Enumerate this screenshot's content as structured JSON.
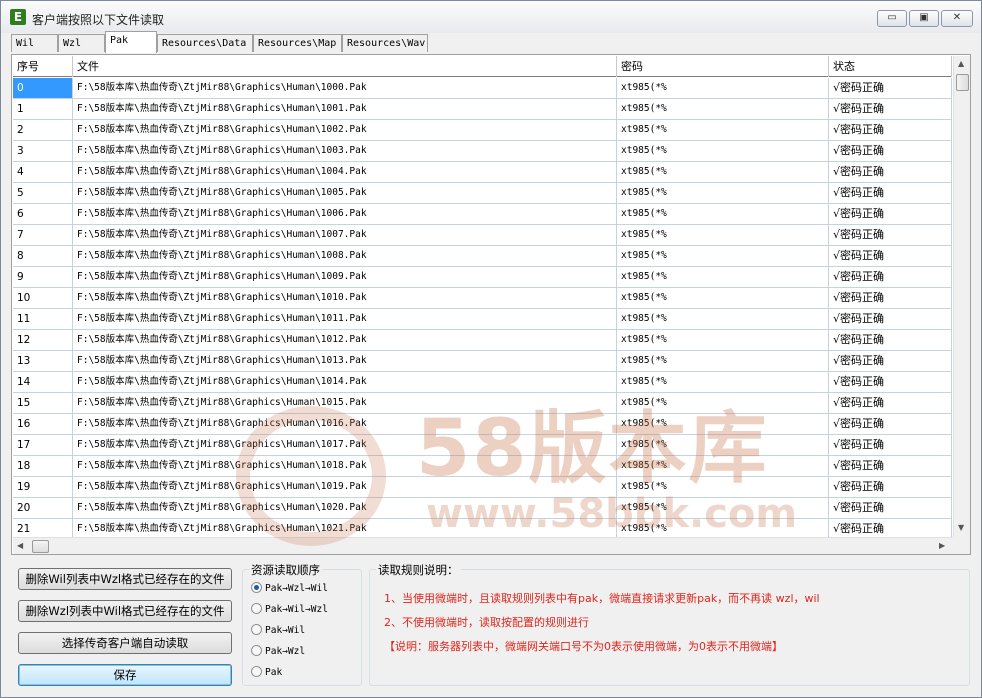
{
  "window": {
    "title": "客户端按照以下文件读取",
    "icon_letter": "E",
    "controls": {
      "minimize": "▭",
      "maximize": "▣",
      "close": "✕"
    }
  },
  "tabs": [
    {
      "label": "Wil",
      "active": false
    },
    {
      "label": "Wzl",
      "active": false
    },
    {
      "label": "Pak",
      "active": true
    },
    {
      "label": "Resources\\Data",
      "active": false
    },
    {
      "label": "Resources\\Map",
      "active": false
    },
    {
      "label": "Resources\\Wav",
      "active": false
    }
  ],
  "grid": {
    "columns": [
      "序号",
      "文件",
      "密码",
      "状态"
    ],
    "selected_row": 0,
    "rows": [
      [
        "0",
        "F:\\58版本库\\热血传奇\\ZtjMir88\\Graphics\\Human\\1000.Pak",
        "xt985(*%",
        "√密码正确"
      ],
      [
        "1",
        "F:\\58版本库\\热血传奇\\ZtjMir88\\Graphics\\Human\\1001.Pak",
        "xt985(*%",
        "√密码正确"
      ],
      [
        "2",
        "F:\\58版本库\\热血传奇\\ZtjMir88\\Graphics\\Human\\1002.Pak",
        "xt985(*%",
        "√密码正确"
      ],
      [
        "3",
        "F:\\58版本库\\热血传奇\\ZtjMir88\\Graphics\\Human\\1003.Pak",
        "xt985(*%",
        "√密码正确"
      ],
      [
        "4",
        "F:\\58版本库\\热血传奇\\ZtjMir88\\Graphics\\Human\\1004.Pak",
        "xt985(*%",
        "√密码正确"
      ],
      [
        "5",
        "F:\\58版本库\\热血传奇\\ZtjMir88\\Graphics\\Human\\1005.Pak",
        "xt985(*%",
        "√密码正确"
      ],
      [
        "6",
        "F:\\58版本库\\热血传奇\\ZtjMir88\\Graphics\\Human\\1006.Pak",
        "xt985(*%",
        "√密码正确"
      ],
      [
        "7",
        "F:\\58版本库\\热血传奇\\ZtjMir88\\Graphics\\Human\\1007.Pak",
        "xt985(*%",
        "√密码正确"
      ],
      [
        "8",
        "F:\\58版本库\\热血传奇\\ZtjMir88\\Graphics\\Human\\1008.Pak",
        "xt985(*%",
        "√密码正确"
      ],
      [
        "9",
        "F:\\58版本库\\热血传奇\\ZtjMir88\\Graphics\\Human\\1009.Pak",
        "xt985(*%",
        "√密码正确"
      ],
      [
        "10",
        "F:\\58版本库\\热血传奇\\ZtjMir88\\Graphics\\Human\\1010.Pak",
        "xt985(*%",
        "√密码正确"
      ],
      [
        "11",
        "F:\\58版本库\\热血传奇\\ZtjMir88\\Graphics\\Human\\1011.Pak",
        "xt985(*%",
        "√密码正确"
      ],
      [
        "12",
        "F:\\58版本库\\热血传奇\\ZtjMir88\\Graphics\\Human\\1012.Pak",
        "xt985(*%",
        "√密码正确"
      ],
      [
        "13",
        "F:\\58版本库\\热血传奇\\ZtjMir88\\Graphics\\Human\\1013.Pak",
        "xt985(*%",
        "√密码正确"
      ],
      [
        "14",
        "F:\\58版本库\\热血传奇\\ZtjMir88\\Graphics\\Human\\1014.Pak",
        "xt985(*%",
        "√密码正确"
      ],
      [
        "15",
        "F:\\58版本库\\热血传奇\\ZtjMir88\\Graphics\\Human\\1015.Pak",
        "xt985(*%",
        "√密码正确"
      ],
      [
        "16",
        "F:\\58版本库\\热血传奇\\ZtjMir88\\Graphics\\Human\\1016.Pak",
        "xt985(*%",
        "√密码正确"
      ],
      [
        "17",
        "F:\\58版本库\\热血传奇\\ZtjMir88\\Graphics\\Human\\1017.Pak",
        "xt985(*%",
        "√密码正确"
      ],
      [
        "18",
        "F:\\58版本库\\热血传奇\\ZtjMir88\\Graphics\\Human\\1018.Pak",
        "xt985(*%",
        "√密码正确"
      ],
      [
        "19",
        "F:\\58版本库\\热血传奇\\ZtjMir88\\Graphics\\Human\\1019.Pak",
        "xt985(*%",
        "√密码正确"
      ],
      [
        "20",
        "F:\\58版本库\\热血传奇\\ZtjMir88\\Graphics\\Human\\1020.Pak",
        "xt985(*%",
        "√密码正确"
      ],
      [
        "21",
        "F:\\58版本库\\热血传奇\\ZtjMir88\\Graphics\\Human\\1021.Pak",
        "xt985(*%",
        "√密码正确"
      ]
    ]
  },
  "buttons": {
    "delete_wil": "删除Wil列表中Wzl格式已经存在的文件",
    "delete_wzl": "删除Wzl列表中Wil格式已经存在的文件",
    "select_client": "选择传奇客户端自动读取",
    "save": "保存"
  },
  "read_order": {
    "title": "资源读取顺序",
    "selected": 0,
    "options": [
      "Pak→Wzl→Wil",
      "Pak→Wil→Wzl",
      "Pak→Wil",
      "Pak→Wzl",
      "Pak"
    ]
  },
  "rules": {
    "title": "读取规则说明：",
    "lines": [
      "1、当使用微端时，且读取规则列表中有pak，微端直接请求更新pak，而不再读 wzl，wil",
      "2、不使用微端时，读取按配置的规则进行",
      "【说明：服务器列表中，微端网关端口号不为0表示使用微端，为0表示不用微端】"
    ]
  },
  "watermark": {
    "brand": "58版本库",
    "url": "www.58bbk.com"
  },
  "colors": {
    "selection": "#3399ff",
    "rules_text": "#e1261c"
  }
}
